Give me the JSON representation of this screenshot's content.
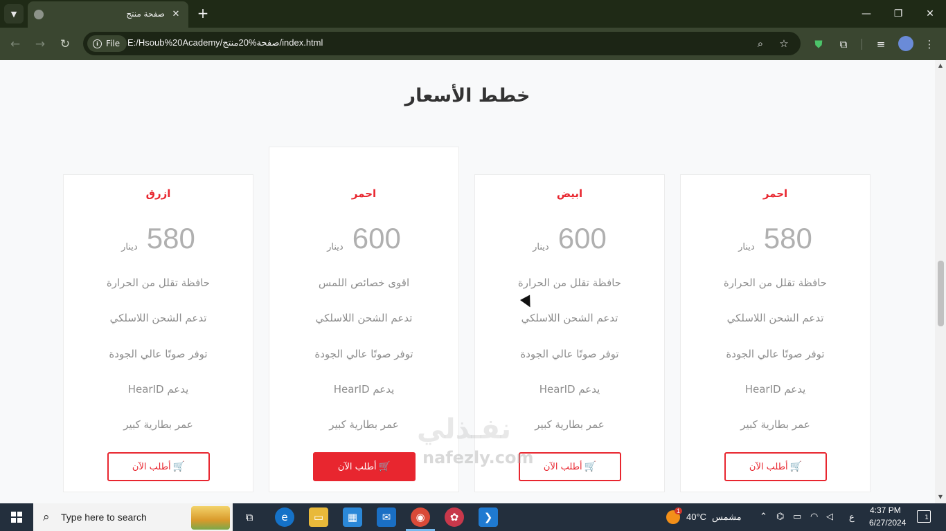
{
  "browser": {
    "tab_title": "صفحة منتج",
    "file_chip": "File",
    "url": "E:/Hsoub%20Academy/صفحة%20منتج/index.html"
  },
  "page": {
    "section_title": "خطط الأسعار",
    "cards": [
      {
        "name": "ازرق",
        "price": "580",
        "currency": "دينار",
        "features": [
          "حافظة تقلل من الحرارة",
          "تدعم الشحن اللاسلكي",
          "توفر صوتًا عالي الجودة",
          "يدعم HearID",
          "عمر بطارية كبير"
        ],
        "button": "أطلب الآن"
      },
      {
        "name": "احمر",
        "price": "600",
        "currency": "دينار",
        "features": [
          "اقوى خصائص اللمس",
          "تدعم الشحن اللاسلكي",
          "توفر صوتًا عالي الجودة",
          "يدعم HearID",
          "عمر بطارية كبير"
        ],
        "button": "أطلب الآن"
      },
      {
        "name": "ابيض",
        "price": "600",
        "currency": "دينار",
        "features": [
          "حافظة تقلل من الحرارة",
          "تدعم الشحن اللاسلكي",
          "توفر صوتًا عالي الجودة",
          "يدعم HearID",
          "عمر بطارية كبير"
        ],
        "button": "أطلب الآن"
      },
      {
        "name": "احمر",
        "price": "580",
        "currency": "دينار",
        "features": [
          "حافظة تقلل من الحرارة",
          "تدعم الشحن اللاسلكي",
          "توفر صوتًا عالي الجودة",
          "يدعم HearID",
          "عمر بطارية كبير"
        ],
        "button": "أطلب الآن"
      }
    ],
    "watermark": "نفـذلي",
    "watermark_url": "nafezly.com"
  },
  "taskbar": {
    "search_placeholder": "Type here to search",
    "temperature": "40°C",
    "weather_label": "مشمس",
    "lang": "ع",
    "time": "4:37 PM",
    "date": "6/27/2024",
    "notification_count": "1",
    "weather_badge": "1"
  },
  "colors": {
    "accent": "#e8262f",
    "chrome_dark": "#1f2a16",
    "chrome_toolbar": "#3a4630",
    "taskbar": "#232f3d"
  }
}
